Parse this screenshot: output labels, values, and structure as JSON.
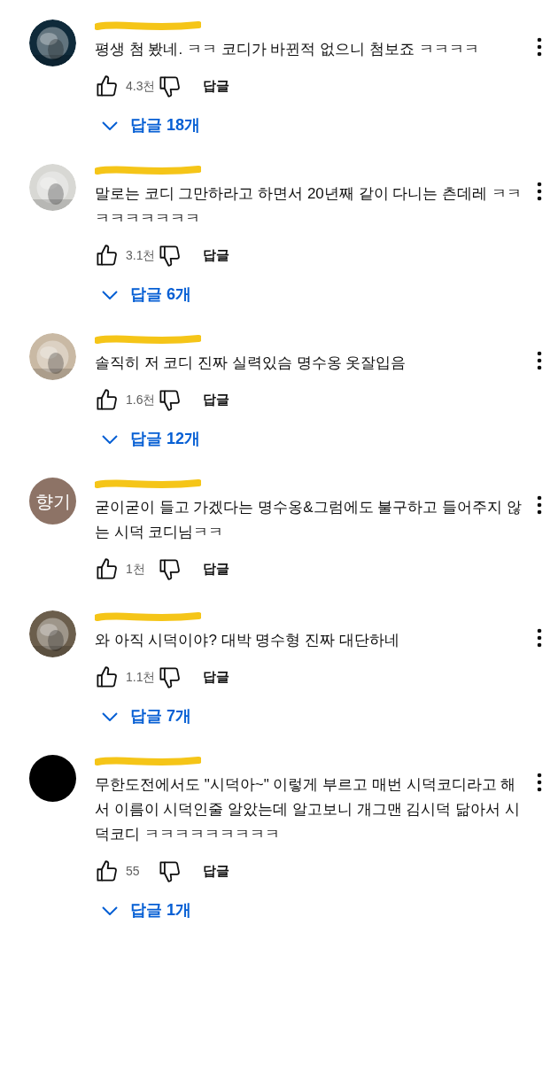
{
  "comments": [
    {
      "text": "평생 첨 봤네. ㅋㅋ 코디가 바뀐적 없으니 첨보죠 ㅋㅋㅋㅋ",
      "likes": "4.3천",
      "reply_label": "답글",
      "replies": "답글 18개"
    },
    {
      "text": "말로는 코디 그만하라고 하면서 20년째 같이 다니는 츤데레 ㅋㅋㅋㅋㅋㅋㅋㅋㅋ",
      "likes": "3.1천",
      "reply_label": "답글",
      "replies": "답글 6개"
    },
    {
      "text": "솔직히 저 코디 진짜 실력있슴 명수옹 옷잘입음",
      "likes": "1.6천",
      "reply_label": "답글",
      "replies": "답글 12개"
    },
    {
      "avatar": {
        "kind": "initials",
        "color": "#8d7366",
        "initials": "향기"
      },
      "text": "굳이굳이 들고 가겠다는 명수옹&그럼에도 불구하고 들어주지 않는 시덕 코디님ㅋㅋ",
      "likes": "1천",
      "reply_label": "답글"
    },
    {
      "text": "와 아직 시덕이야? 대박 명수형 진짜 대단하네",
      "likes": "1.1천",
      "reply_label": "답글",
      "replies": "답글 7개"
    },
    {
      "avatar": {
        "kind": "plain",
        "color": "#000000"
      },
      "text": "무한도전에서도 \"시덕아~\" 이렇게 부르고 매번 시덕코디라고 해서 이름이 시덕인줄 알았는데 알고보니 개그맨 김시덕 닮아서 시덕코디 ㅋㅋㅋㅋㅋㅋㅋㅋㅋ",
      "likes": "55",
      "reply_label": "답글",
      "replies": "답글 1개"
    }
  ]
}
